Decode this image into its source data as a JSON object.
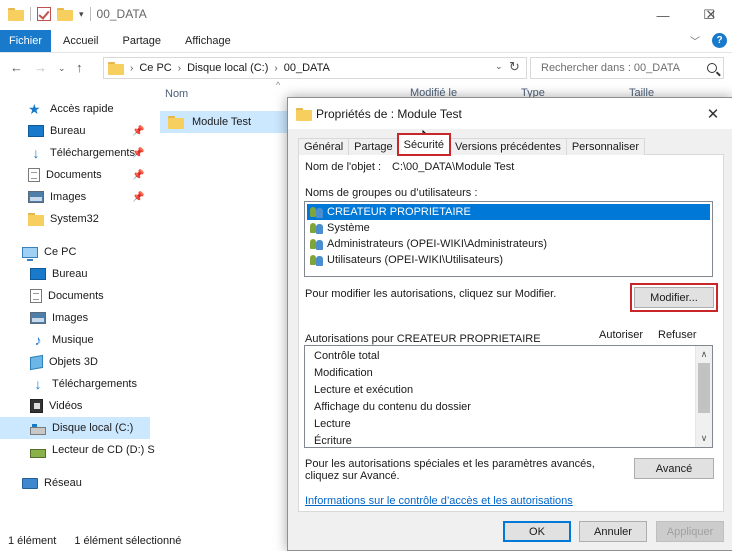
{
  "window": {
    "title": "00_DATA",
    "controls": {
      "minimize": "—",
      "maximize": "☐",
      "close": "✕"
    }
  },
  "ribbon": {
    "tabs": [
      "Fichier",
      "Accueil",
      "Partage",
      "Affichage"
    ],
    "help": "?"
  },
  "address": {
    "crumbs": [
      "Ce PC",
      "Disque local (C:)",
      "00_DATA"
    ],
    "search_placeholder": "Rechercher dans : 00_DATA"
  },
  "nav": {
    "quick_access": "Accès rapide",
    "quick_items": [
      "Bureau",
      "Téléchargements",
      "Documents",
      "Images",
      "System32"
    ],
    "this_pc": "Ce PC",
    "pc_items": [
      "Bureau",
      "Documents",
      "Images",
      "Musique",
      "Objets 3D",
      "Téléchargements",
      "Vidéos",
      "Disque local (C:)",
      "Lecteur de CD (D:) S"
    ],
    "network": "Réseau"
  },
  "filelist": {
    "headers": {
      "name": "Nom",
      "modified": "Modifié le",
      "type": "Type",
      "size": "Taille"
    },
    "rows": [
      "Module Test"
    ]
  },
  "status": {
    "count": "1 élément",
    "selected": "1 élément sélectionné"
  },
  "dialog": {
    "title": "Propriétés de : Module Test",
    "close": "✕",
    "tabs": [
      "Général",
      "Partage",
      "Sécurité",
      "Versions précédentes",
      "Personnaliser"
    ],
    "active_tab": "Sécurité",
    "object_label": "Nom de l'objet :",
    "object_value": "C:\\00_DATA\\Module Test",
    "groups_label": "Noms de groupes ou d’utilisateurs :",
    "groups": [
      "CREATEUR PROPRIETAIRE",
      "Système",
      "Administrateurs (OPEI-WIKI\\Administrateurs)",
      "Utilisateurs (OPEI-WIKI\\Utilisateurs)"
    ],
    "modify_hint": "Pour modifier les autorisations, cliquez sur Modifier.",
    "modify_button": "Modifier...",
    "perms_label": "Autorisations pour CREATEUR PROPRIETAIRE",
    "allow_header": "Autoriser",
    "deny_header": "Refuser",
    "permissions": [
      "Contrôle total",
      "Modification",
      "Lecture et exécution",
      "Affichage du contenu du dossier",
      "Lecture",
      "Écriture"
    ],
    "advanced_hint": "Pour les autorisations spéciales et les paramètres avancés, cliquez sur Avancé.",
    "advanced_button": "Avancé",
    "info_link": "Informations sur le contrôle d’accès et les autorisations",
    "ok": "OK",
    "cancel": "Annuler",
    "apply": "Appliquer"
  },
  "colors": {
    "accent": "#1979ca",
    "selection": "#cce8ff",
    "list_selection": "#0078d7",
    "highlight_box": "#c9262a"
  }
}
